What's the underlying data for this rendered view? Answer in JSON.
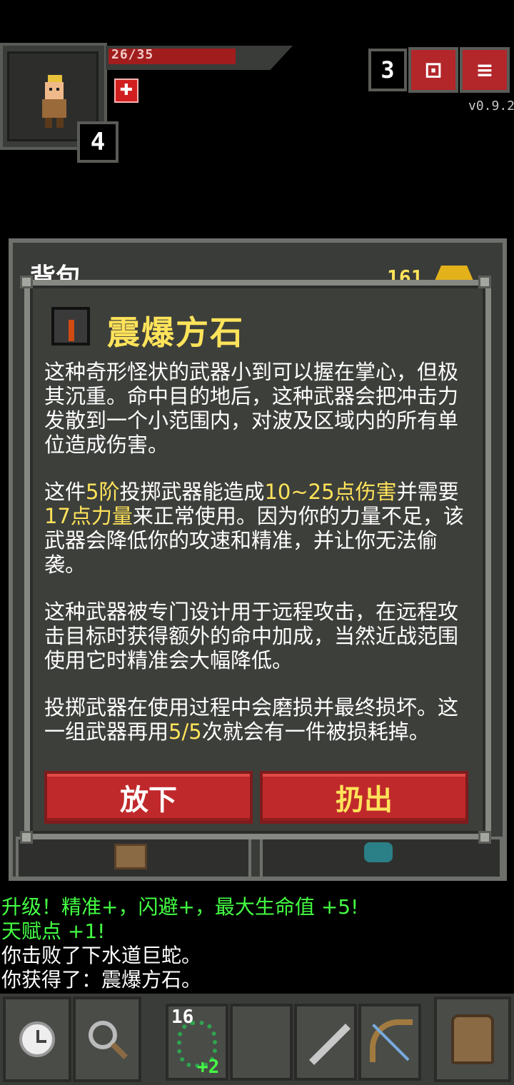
{
  "status": {
    "hp_text": "26/35",
    "hp_fraction": 0.743,
    "hero_level": "4",
    "dungeon_depth": "3",
    "version": "v0.9.2"
  },
  "top_buttons": {
    "journal_icon": "journal-icon",
    "menu_icon": "menu-icon"
  },
  "backpack": {
    "title": "背包",
    "gold_count": "161"
  },
  "item_dialog": {
    "title": "震爆方石",
    "para1": "这种奇形怪状的武器小到可以握在掌心，但极其沉重。命中目的地后，这种武器会把冲击力发散到一个小范围内，对波及区域内的所有单位造成伤害。",
    "para2": {
      "t1": "这件",
      "tier": "5阶",
      "t2": "投掷武器能造成",
      "damage": "10~25点伤害",
      "t3": "并需要",
      "strength": "17点力量",
      "t4": "来正常使用。因为你的力量不足，该武器会降低你的攻速和精准，并让你无法偷袭。"
    },
    "para3": "这种武器被专门设计用于远程攻击，在远程攻击目标时获得额外的命中加成，当然近战范围使用它时精准会大幅降低。",
    "para4": {
      "t1": "投掷武器在使用过程中会磨损并最终损坏。这一组武器再用",
      "uses": "5/5",
      "t2": "次就会有一件被损耗掉。"
    },
    "drop_label": "放下",
    "throw_label": "扔出"
  },
  "log": [
    {
      "text": "升级！精准+，闪避+，最大生命值 +5!",
      "color": "#44ff44"
    },
    {
      "text": "天赋点 +1!",
      "color": "#44ff44"
    },
    {
      "text": "你击败了下水道巨蛇。",
      "color": "#ffffff"
    },
    {
      "text": "你获得了：震爆方石。",
      "color": "#ffffff"
    }
  ],
  "toolbar": {
    "quickslot1_count": "16",
    "quickslot1_bonus": "+2"
  }
}
